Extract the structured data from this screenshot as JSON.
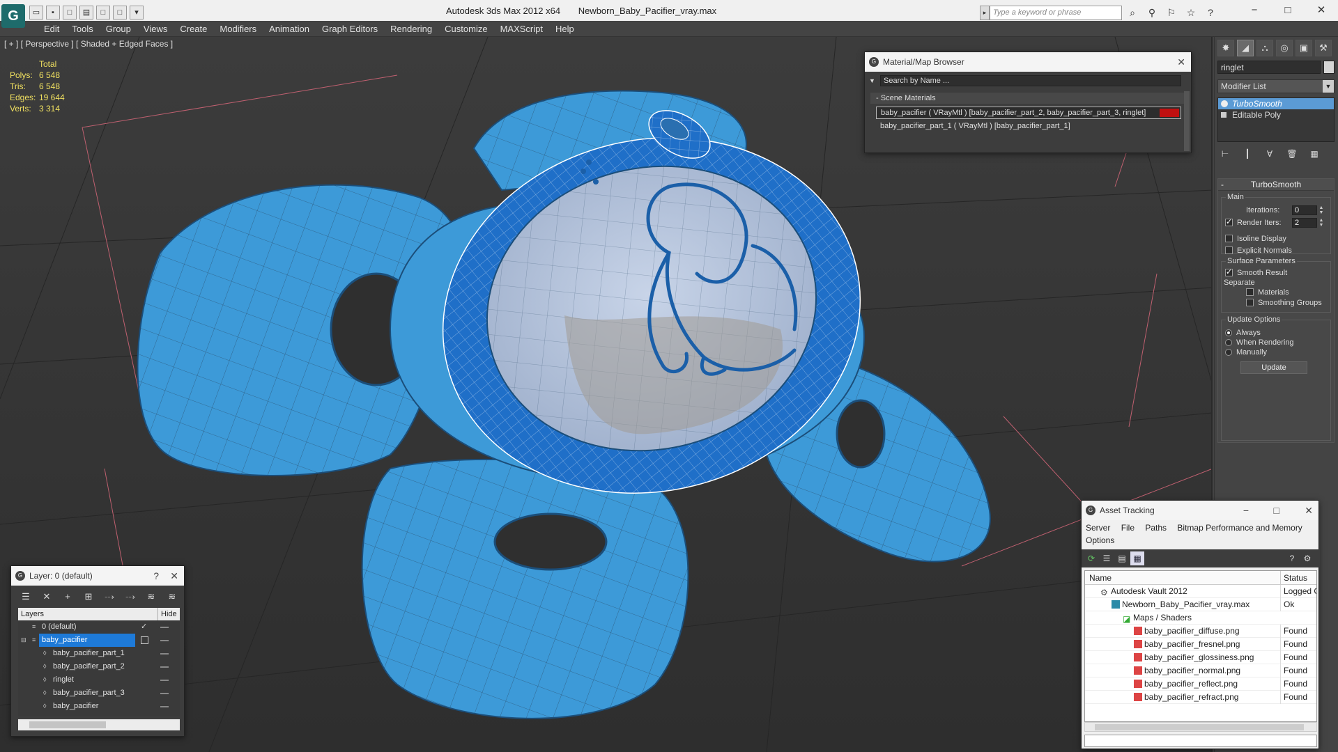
{
  "app": {
    "logo": "G",
    "title_app": "Autodesk 3ds Max  2012 x64",
    "title_file": "Newborn_Baby_Pacifier_vray.max",
    "search_placeholder": "Type a keyword or phrase"
  },
  "menu": [
    "Edit",
    "Tools",
    "Group",
    "Views",
    "Create",
    "Modifiers",
    "Animation",
    "Graph Editors",
    "Rendering",
    "Customize",
    "MAXScript",
    "Help"
  ],
  "viewport": {
    "label": "[ + ] [ Perspective ] [ Shaded + Edged Faces ]",
    "stats": {
      "header": "Total",
      "rows": [
        {
          "k": "Polys:",
          "v": "6 548"
        },
        {
          "k": "Tris:",
          "v": "6 548"
        },
        {
          "k": "Edges:",
          "v": "19 644"
        },
        {
          "k": "Verts:",
          "v": "3 314"
        }
      ]
    }
  },
  "command_panel": {
    "object_name": "ringlet",
    "modifier_list": "Modifier List",
    "stack": [
      {
        "label": "TurboSmooth",
        "selected": true
      },
      {
        "label": "Editable Poly",
        "selected": false
      }
    ],
    "rollout_title": "TurboSmooth",
    "main_label": "Main",
    "iterations_label": "Iterations:",
    "iterations_value": "0",
    "render_iters_label": "Render Iters:",
    "render_iters_value": "2",
    "isoline_label": "Isoline Display",
    "explicit_normals_label": "Explicit Normals",
    "surface_label": "Surface Parameters",
    "smooth_result_label": "Smooth Result",
    "separate_label": "Separate",
    "materials_label": "Materials",
    "smoothing_groups_label": "Smoothing Groups",
    "update_options_label": "Update Options",
    "always_label": "Always",
    "when_rendering_label": "When Rendering",
    "manually_label": "Manually",
    "update_button": "Update"
  },
  "material_browser": {
    "title": "Material/Map Browser",
    "search": "Search by Name ...",
    "group": "Scene Materials",
    "rows": [
      "baby_pacifier  ( VRayMtl ) [baby_pacifier_part_2, baby_pacifier_part_3, ringlet]",
      "baby_pacifier_part_1  ( VRayMtl ) [baby_pacifier_part_1]"
    ],
    "swatch_color": "#c01010"
  },
  "layer_manager": {
    "title": "Layer: 0 (default)",
    "help": "?",
    "col_layers": "Layers",
    "col_hide": "Hide",
    "rows": [
      {
        "label": "0 (default)",
        "indent": 1
      },
      {
        "label": "baby_pacifier",
        "indent": 1
      },
      {
        "label": "baby_pacifier_part_1",
        "indent": 2
      },
      {
        "label": "baby_pacifier_part_2",
        "indent": 2
      },
      {
        "label": "ringlet",
        "indent": 2
      },
      {
        "label": "baby_pacifier_part_3",
        "indent": 2
      },
      {
        "label": "baby_pacifier",
        "indent": 2
      }
    ]
  },
  "asset_tracking": {
    "title": "Asset Tracking",
    "menu": [
      "Server",
      "File",
      "Paths",
      "Bitmap Performance and Memory"
    ],
    "menu2": "Options",
    "col_name": "Name",
    "col_status": "Status",
    "rows": [
      {
        "name": "Autodesk Vault 2012",
        "status": "Logged C",
        "indent": 1
      },
      {
        "name": "Newborn_Baby_Pacifier_vray.max",
        "status": "Ok",
        "indent": 2
      },
      {
        "name": "Maps / Shaders",
        "status": "",
        "indent": 3
      },
      {
        "name": "baby_pacifier_diffuse.png",
        "status": "Found",
        "indent": 4
      },
      {
        "name": "baby_pacifier_fresnel.png",
        "status": "Found",
        "indent": 4
      },
      {
        "name": "baby_pacifier_glossiness.png",
        "status": "Found",
        "indent": 4
      },
      {
        "name": "baby_pacifier_normal.png",
        "status": "Found",
        "indent": 4
      },
      {
        "name": "baby_pacifier_reflect.png",
        "status": "Found",
        "indent": 4
      },
      {
        "name": "baby_pacifier_refract.png",
        "status": "Found",
        "indent": 4
      }
    ]
  },
  "colors": {
    "pacifier_blue": "#3d9ad8",
    "ring_blue": "#1f6fc8",
    "selection_blue": "#1e7ad8"
  }
}
